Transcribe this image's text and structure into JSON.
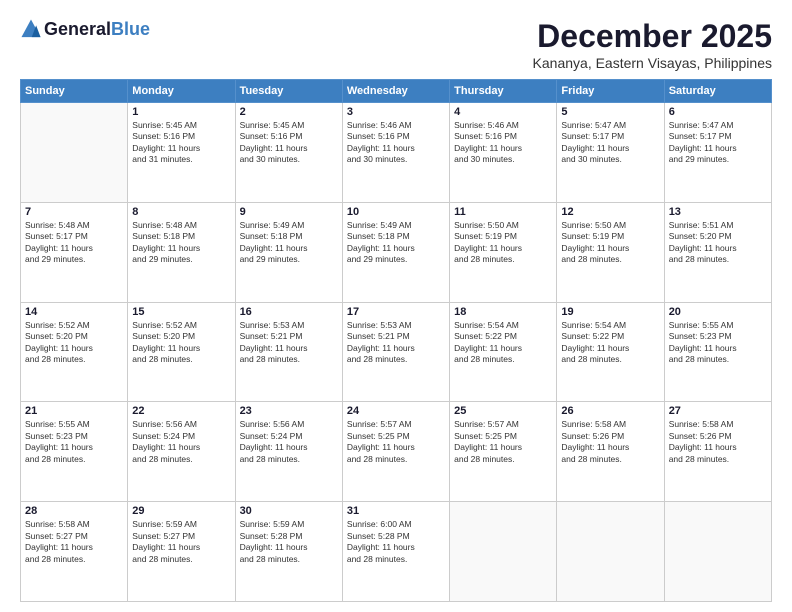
{
  "header": {
    "logo_general": "General",
    "logo_blue": "Blue",
    "month": "December 2025",
    "location": "Kananya, Eastern Visayas, Philippines"
  },
  "weekdays": [
    "Sunday",
    "Monday",
    "Tuesday",
    "Wednesday",
    "Thursday",
    "Friday",
    "Saturday"
  ],
  "weeks": [
    [
      {
        "day": "",
        "info": ""
      },
      {
        "day": "1",
        "info": "Sunrise: 5:45 AM\nSunset: 5:16 PM\nDaylight: 11 hours\nand 31 minutes."
      },
      {
        "day": "2",
        "info": "Sunrise: 5:45 AM\nSunset: 5:16 PM\nDaylight: 11 hours\nand 30 minutes."
      },
      {
        "day": "3",
        "info": "Sunrise: 5:46 AM\nSunset: 5:16 PM\nDaylight: 11 hours\nand 30 minutes."
      },
      {
        "day": "4",
        "info": "Sunrise: 5:46 AM\nSunset: 5:16 PM\nDaylight: 11 hours\nand 30 minutes."
      },
      {
        "day": "5",
        "info": "Sunrise: 5:47 AM\nSunset: 5:17 PM\nDaylight: 11 hours\nand 30 minutes."
      },
      {
        "day": "6",
        "info": "Sunrise: 5:47 AM\nSunset: 5:17 PM\nDaylight: 11 hours\nand 29 minutes."
      }
    ],
    [
      {
        "day": "7",
        "info": "Sunrise: 5:48 AM\nSunset: 5:17 PM\nDaylight: 11 hours\nand 29 minutes."
      },
      {
        "day": "8",
        "info": "Sunrise: 5:48 AM\nSunset: 5:18 PM\nDaylight: 11 hours\nand 29 minutes."
      },
      {
        "day": "9",
        "info": "Sunrise: 5:49 AM\nSunset: 5:18 PM\nDaylight: 11 hours\nand 29 minutes."
      },
      {
        "day": "10",
        "info": "Sunrise: 5:49 AM\nSunset: 5:18 PM\nDaylight: 11 hours\nand 29 minutes."
      },
      {
        "day": "11",
        "info": "Sunrise: 5:50 AM\nSunset: 5:19 PM\nDaylight: 11 hours\nand 28 minutes."
      },
      {
        "day": "12",
        "info": "Sunrise: 5:50 AM\nSunset: 5:19 PM\nDaylight: 11 hours\nand 28 minutes."
      },
      {
        "day": "13",
        "info": "Sunrise: 5:51 AM\nSunset: 5:20 PM\nDaylight: 11 hours\nand 28 minutes."
      }
    ],
    [
      {
        "day": "14",
        "info": "Sunrise: 5:52 AM\nSunset: 5:20 PM\nDaylight: 11 hours\nand 28 minutes."
      },
      {
        "day": "15",
        "info": "Sunrise: 5:52 AM\nSunset: 5:20 PM\nDaylight: 11 hours\nand 28 minutes."
      },
      {
        "day": "16",
        "info": "Sunrise: 5:53 AM\nSunset: 5:21 PM\nDaylight: 11 hours\nand 28 minutes."
      },
      {
        "day": "17",
        "info": "Sunrise: 5:53 AM\nSunset: 5:21 PM\nDaylight: 11 hours\nand 28 minutes."
      },
      {
        "day": "18",
        "info": "Sunrise: 5:54 AM\nSunset: 5:22 PM\nDaylight: 11 hours\nand 28 minutes."
      },
      {
        "day": "19",
        "info": "Sunrise: 5:54 AM\nSunset: 5:22 PM\nDaylight: 11 hours\nand 28 minutes."
      },
      {
        "day": "20",
        "info": "Sunrise: 5:55 AM\nSunset: 5:23 PM\nDaylight: 11 hours\nand 28 minutes."
      }
    ],
    [
      {
        "day": "21",
        "info": "Sunrise: 5:55 AM\nSunset: 5:23 PM\nDaylight: 11 hours\nand 28 minutes."
      },
      {
        "day": "22",
        "info": "Sunrise: 5:56 AM\nSunset: 5:24 PM\nDaylight: 11 hours\nand 28 minutes."
      },
      {
        "day": "23",
        "info": "Sunrise: 5:56 AM\nSunset: 5:24 PM\nDaylight: 11 hours\nand 28 minutes."
      },
      {
        "day": "24",
        "info": "Sunrise: 5:57 AM\nSunset: 5:25 PM\nDaylight: 11 hours\nand 28 minutes."
      },
      {
        "day": "25",
        "info": "Sunrise: 5:57 AM\nSunset: 5:25 PM\nDaylight: 11 hours\nand 28 minutes."
      },
      {
        "day": "26",
        "info": "Sunrise: 5:58 AM\nSunset: 5:26 PM\nDaylight: 11 hours\nand 28 minutes."
      },
      {
        "day": "27",
        "info": "Sunrise: 5:58 AM\nSunset: 5:26 PM\nDaylight: 11 hours\nand 28 minutes."
      }
    ],
    [
      {
        "day": "28",
        "info": "Sunrise: 5:58 AM\nSunset: 5:27 PM\nDaylight: 11 hours\nand 28 minutes."
      },
      {
        "day": "29",
        "info": "Sunrise: 5:59 AM\nSunset: 5:27 PM\nDaylight: 11 hours\nand 28 minutes."
      },
      {
        "day": "30",
        "info": "Sunrise: 5:59 AM\nSunset: 5:28 PM\nDaylight: 11 hours\nand 28 minutes."
      },
      {
        "day": "31",
        "info": "Sunrise: 6:00 AM\nSunset: 5:28 PM\nDaylight: 11 hours\nand 28 minutes."
      },
      {
        "day": "",
        "info": ""
      },
      {
        "day": "",
        "info": ""
      },
      {
        "day": "",
        "info": ""
      }
    ]
  ]
}
